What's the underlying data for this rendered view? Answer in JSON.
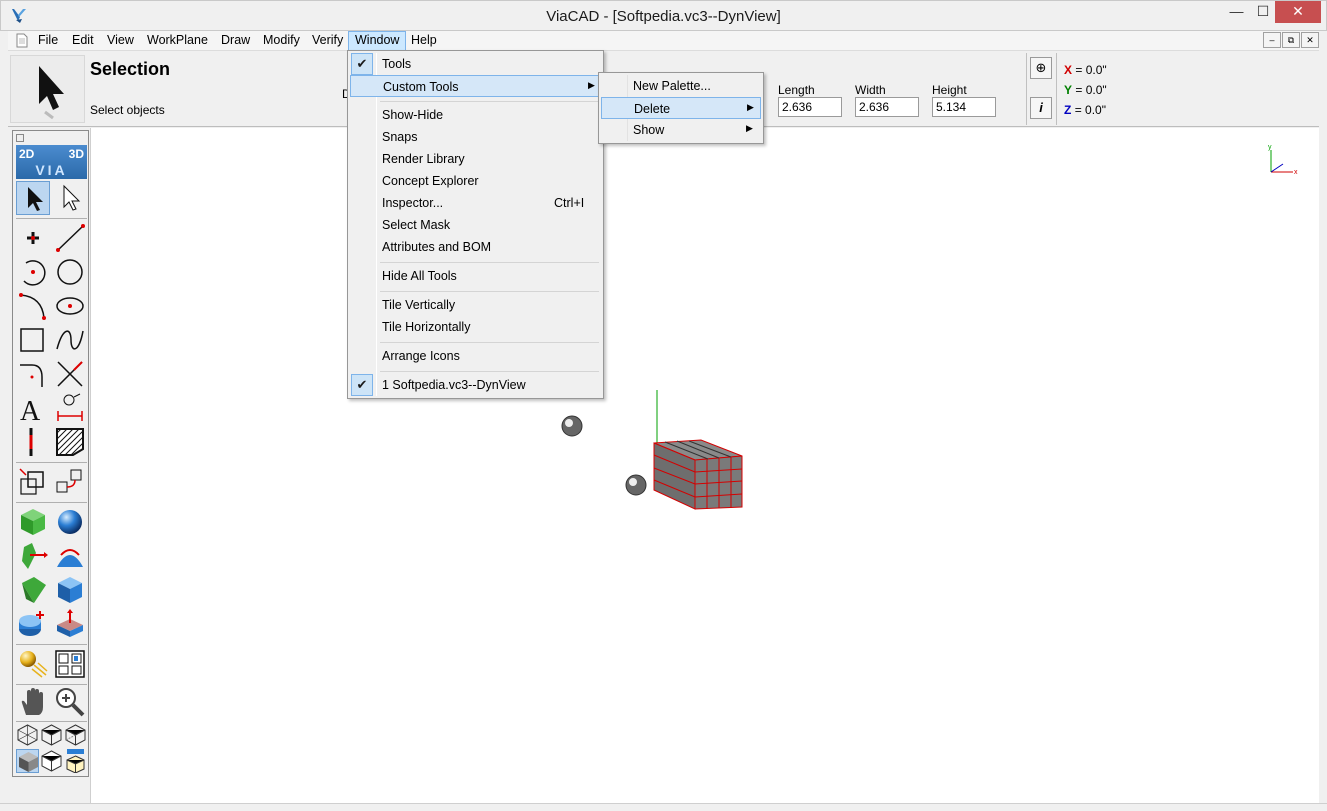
{
  "window": {
    "title": "ViaCAD - [Softpedia.vc3--DynView]",
    "minimize": "—",
    "maximize": "☐",
    "close": "✕"
  },
  "menubar": {
    "items": [
      "File",
      "Edit",
      "View",
      "WorkPlane",
      "Draw",
      "Modify",
      "Verify",
      "Window",
      "Help"
    ],
    "active": "Window",
    "mdi": [
      "–",
      "⧉",
      "✕"
    ]
  },
  "propbar": {
    "tool_title": "Selection",
    "tool_hint": "Select objects",
    "partial_label": "D",
    "fields": [
      {
        "label": "Length",
        "value": "2.636"
      },
      {
        "label": "Width",
        "value": "2.636"
      },
      {
        "label": "Height",
        "value": "5.134"
      }
    ],
    "buttons": {
      "snap": "⊕",
      "info": "i"
    },
    "coords": [
      {
        "axis": "X",
        "value": "= 0.0\"",
        "color": "#d00000"
      },
      {
        "axis": "Y",
        "value": "= 0.0\"",
        "color": "#008000"
      },
      {
        "axis": "Z",
        "value": "= 0.0\"",
        "color": "#0000c0"
      }
    ]
  },
  "toolbox": {
    "mode_left": "2D",
    "mode_right": "3D",
    "brand": "VIA"
  },
  "window_menu": {
    "items": [
      {
        "label": "Tools",
        "checked": true
      },
      {
        "label": "Custom Tools",
        "submenu": true,
        "highlighted": true
      },
      {
        "label": "Show-Hide"
      },
      {
        "label": "Snaps"
      },
      {
        "label": "Render Library"
      },
      {
        "label": "Concept Explorer"
      },
      {
        "label": "Inspector...",
        "shortcut": "Ctrl+I"
      },
      {
        "label": "Select Mask"
      },
      {
        "label": "Attributes and BOM"
      },
      {
        "label": "Hide All Tools"
      },
      {
        "label": "Tile Vertically"
      },
      {
        "label": "Tile Horizontally"
      },
      {
        "label": "Arrange Icons"
      },
      {
        "label": "1 Softpedia.vc3--DynView",
        "checked": true
      }
    ],
    "check_mark": "✔",
    "arrow": "▶"
  },
  "custom_tools_submenu": {
    "items": [
      {
        "label": "New Palette..."
      },
      {
        "label": "Delete",
        "submenu": true,
        "highlighted": true
      },
      {
        "label": "Show",
        "submenu": true
      }
    ]
  },
  "viewport": {
    "axis_labels": {
      "y": "y",
      "x": "x"
    },
    "colors": {
      "box_edge": "#d40000",
      "box_face": "#6e6e6e",
      "axis_green": "#00a000"
    }
  }
}
